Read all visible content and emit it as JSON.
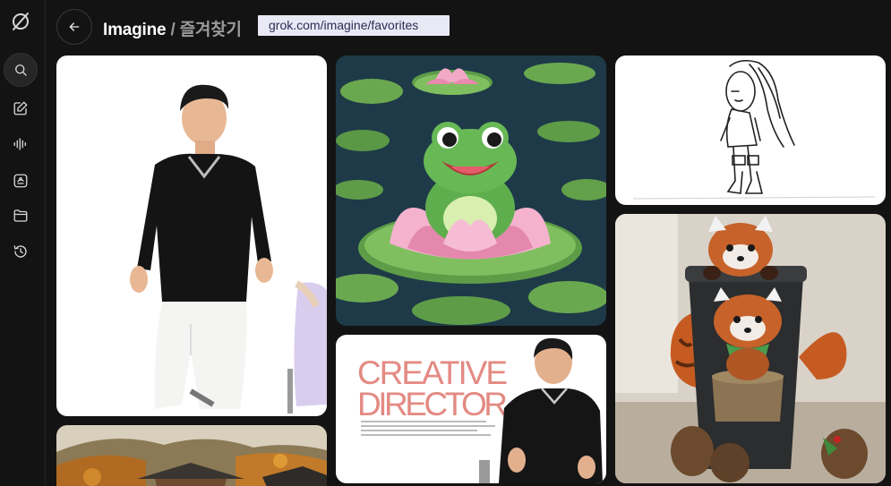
{
  "sidebar": {
    "items": [
      {
        "icon": "grok-logo-icon"
      },
      {
        "icon": "search-icon",
        "active": true
      },
      {
        "icon": "edit-icon"
      },
      {
        "icon": "voice-icon"
      },
      {
        "icon": "imagine-icon"
      },
      {
        "icon": "folder-icon"
      },
      {
        "icon": "history-icon"
      }
    ]
  },
  "header": {
    "back_icon": "arrow-left-icon",
    "title": "Imagine",
    "separator": "/",
    "subtitle": "즐겨찾기",
    "url": "grok.com/imagine/favorites"
  },
  "gallery": {
    "images": [
      {
        "id": "man-walking",
        "kind": "photo"
      },
      {
        "id": "autumn-temple",
        "kind": "photo"
      },
      {
        "id": "frog-lotus",
        "kind": "illustration"
      },
      {
        "id": "creative-director",
        "kind": "photo",
        "line1": "CREATIVE",
        "line2": "DIRECTOR"
      },
      {
        "id": "sketch-character",
        "kind": "drawing"
      },
      {
        "id": "red-panda-cup",
        "kind": "illustration"
      }
    ]
  }
}
